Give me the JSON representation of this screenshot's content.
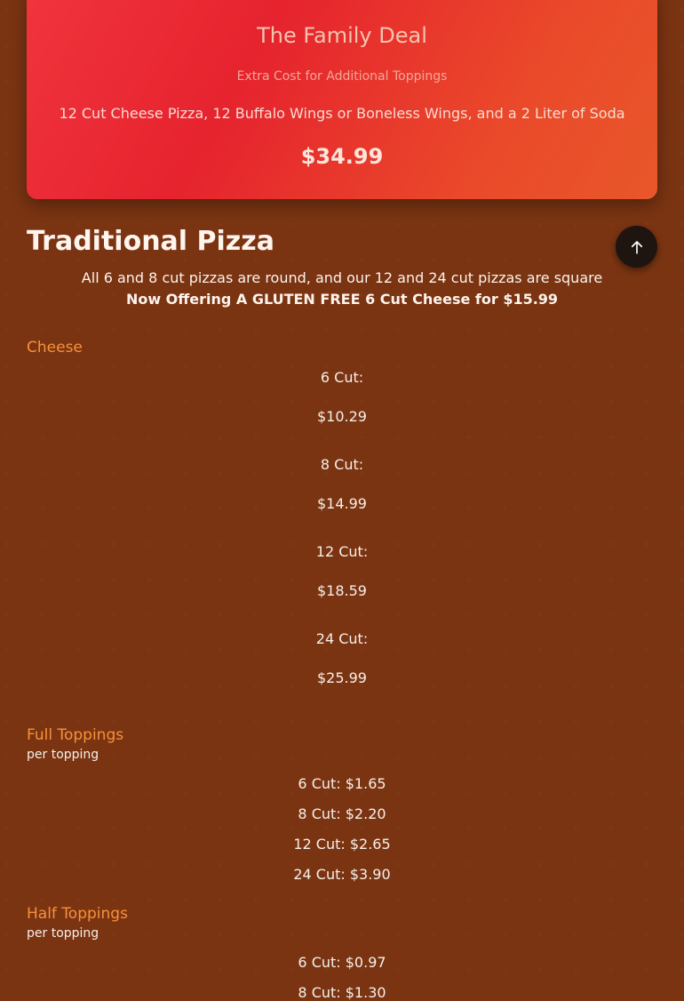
{
  "deal": {
    "title": "The Family Deal",
    "note": "Extra Cost for Additional Toppings",
    "description": "12 Cut Cheese Pizza, 12 Buffalo Wings or Boneless Wings, and a 2 Liter of Soda",
    "price": "$34.99"
  },
  "section": {
    "title": "Traditional Pizza",
    "info_line1": "All 6 and 8 cut pizzas are round, and our 12 and 24 cut pizzas are square",
    "info_line2": "Now Offering A GLUTEN FREE 6 Cut Cheese for $15.99"
  },
  "scroll_top_icon": "arrow-up-icon",
  "cheese": {
    "title": "Cheese",
    "prices": [
      {
        "label": "6 Cut:",
        "value": "$10.29"
      },
      {
        "label": "8 Cut:",
        "value": "$14.99"
      },
      {
        "label": "12 Cut:",
        "value": "$18.59"
      },
      {
        "label": "24 Cut:",
        "value": "$25.99"
      }
    ]
  },
  "full_toppings": {
    "title": "Full Toppings",
    "subtitle": "per topping",
    "prices": [
      "6 Cut: $1.65",
      "8 Cut: $2.20",
      "12 Cut: $2.65",
      "24 Cut: $3.90"
    ]
  },
  "half_toppings": {
    "title": "Half Toppings",
    "subtitle": "per topping",
    "prices": [
      "6 Cut: $0.97",
      "8 Cut: $1.30"
    ]
  },
  "colors": {
    "background": "#7a3412",
    "deal_gradient_start": "#f0343d",
    "deal_gradient_end": "#e8572a",
    "category_accent": "#f7913c",
    "scroll_button": "#1e1410"
  }
}
